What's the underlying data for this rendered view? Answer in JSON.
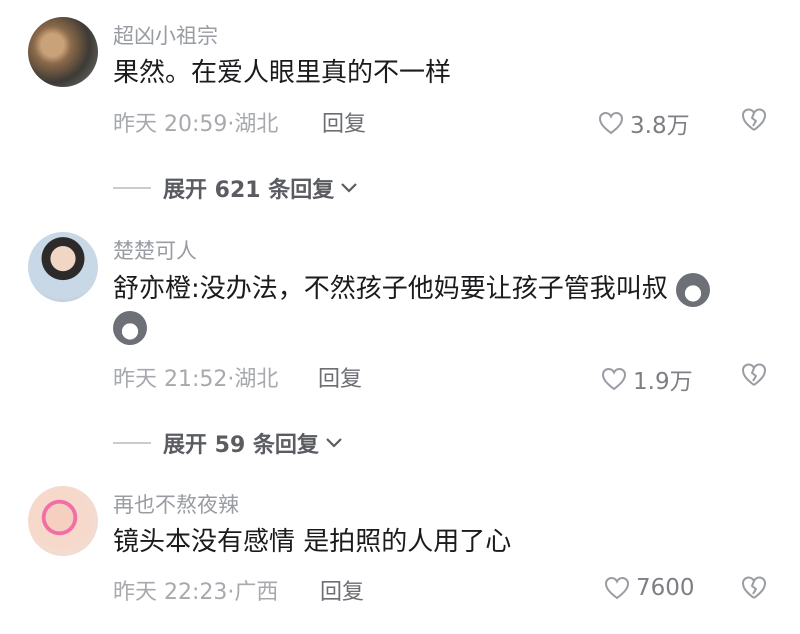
{
  "comments": [
    {
      "username": "超凶小祖宗",
      "text": "果然。在爱人眼里真的不一样",
      "meta": "昨天 20:59·湖北",
      "reply_label": "回复",
      "likes": "3.8万",
      "expand": "展开 621 条回复"
    },
    {
      "username": "楚楚可人",
      "text_line1": "舒亦橙:没办法，不然孩子他妈要让孩子管我叫叔",
      "meta": "昨天 21:52·湖北",
      "reply_label": "回复",
      "likes": "1.9万",
      "expand": "展开 59 条回复"
    },
    {
      "username": "再也不熬夜辣",
      "text": "镜头本没有感情 是拍照的人用了心",
      "meta": "昨天 22:23·广西",
      "reply_label": "回复",
      "likes": "7600"
    }
  ],
  "icons": {
    "like": "heart-outline-icon",
    "dislike": "broken-heart-icon",
    "chevron": "chevron-down-icon",
    "emoji": "dog-emoji-icon"
  },
  "colors": {
    "username": "#9a9ca3",
    "text": "#1b1b1d",
    "meta": "#a7a9ae"
  }
}
